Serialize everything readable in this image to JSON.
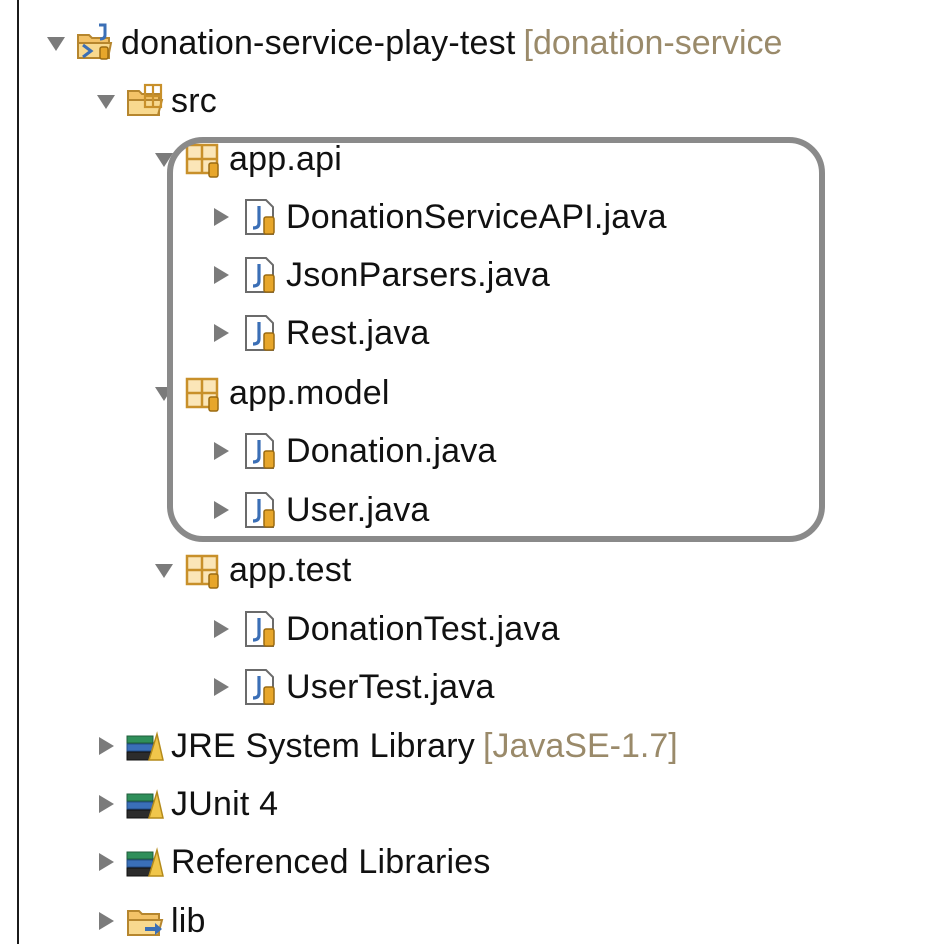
{
  "tree": {
    "project": {
      "label": "donation-service-play-test",
      "decoration": "[donation-service"
    },
    "src": {
      "label": "src"
    },
    "pkg_api": {
      "label": "app.api"
    },
    "file_api_1": {
      "label": "DonationServiceAPI.java"
    },
    "file_api_2": {
      "label": "JsonParsers.java"
    },
    "file_api_3": {
      "label": "Rest.java"
    },
    "pkg_model": {
      "label": "app.model"
    },
    "file_model_1": {
      "label": "Donation.java"
    },
    "file_model_2": {
      "label": "User.java"
    },
    "pkg_test": {
      "label": "app.test"
    },
    "file_test_1": {
      "label": "DonationTest.java"
    },
    "file_test_2": {
      "label": "UserTest.java"
    },
    "jre": {
      "label": "JRE System Library",
      "decoration": "[JavaSE-1.7]"
    },
    "junit": {
      "label": "JUnit 4"
    },
    "reflibs": {
      "label": "Referenced Libraries"
    },
    "lib": {
      "label": "lib"
    }
  },
  "colors": {
    "highlight_border": "#8a8a8a",
    "decoration_text": "#9a8a6a",
    "package_icon": "#c8902a",
    "java_file_icon": "#3b6fb6"
  },
  "icons": {
    "expanded": "triangle-down-icon",
    "collapsed": "triangle-right-icon",
    "project": "java-project-icon",
    "source_folder": "source-folder-icon",
    "package": "package-icon",
    "java_file": "java-file-icon",
    "library": "library-icon",
    "folder": "folder-icon"
  }
}
